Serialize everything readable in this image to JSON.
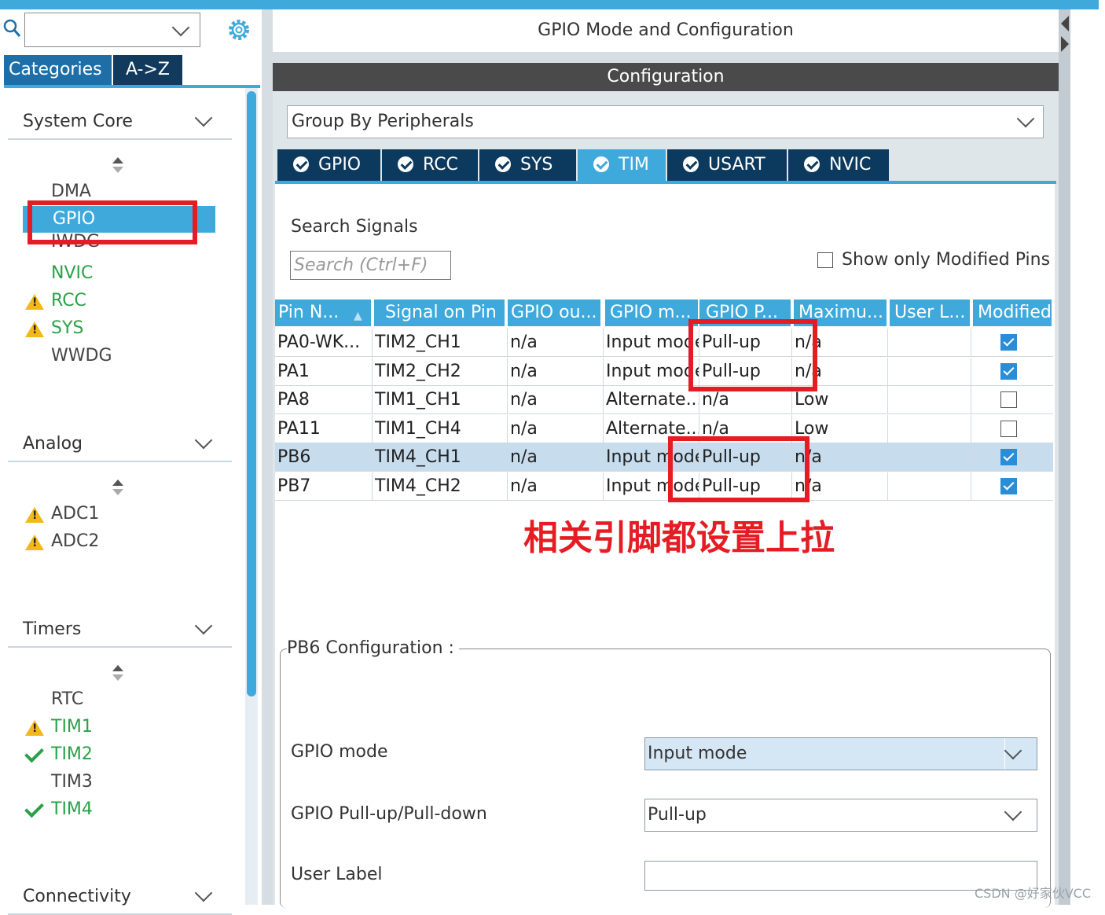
{
  "header": {
    "title": "GPIO Mode and Configuration",
    "config_bar": "Configuration"
  },
  "left": {
    "search_value": "",
    "tabs": [
      "Categories",
      "A->Z"
    ],
    "sections": [
      {
        "name": "System Core"
      },
      {
        "name": "Analog"
      },
      {
        "name": "Timers"
      },
      {
        "name": "Connectivity"
      }
    ],
    "system_core_items": [
      {
        "label": "DMA",
        "status": "none",
        "color": "gray"
      },
      {
        "label": "GPIO",
        "status": "selected",
        "color": "white"
      },
      {
        "label": "IWDG",
        "status": "none",
        "color": "gray"
      },
      {
        "label": "NVIC",
        "status": "none",
        "color": "green"
      },
      {
        "label": "RCC",
        "status": "warning",
        "color": "green"
      },
      {
        "label": "SYS",
        "status": "warning",
        "color": "green"
      },
      {
        "label": "WWDG",
        "status": "none",
        "color": "gray"
      }
    ],
    "analog_items": [
      {
        "label": "ADC1",
        "status": "warning",
        "color": "gray"
      },
      {
        "label": "ADC2",
        "status": "warning",
        "color": "gray"
      }
    ],
    "timer_items": [
      {
        "label": "RTC",
        "status": "none",
        "color": "gray"
      },
      {
        "label": "TIM1",
        "status": "warning",
        "color": "green"
      },
      {
        "label": "TIM2",
        "status": "ok",
        "color": "green"
      },
      {
        "label": "TIM3",
        "status": "none",
        "color": "gray"
      },
      {
        "label": "TIM4",
        "status": "ok",
        "color": "green"
      }
    ]
  },
  "config": {
    "group_by": "Group By Peripherals",
    "peripheral_tabs": [
      {
        "label": "GPIO",
        "active": false
      },
      {
        "label": "RCC",
        "active": false
      },
      {
        "label": "SYS",
        "active": false
      },
      {
        "label": "TIM",
        "active": true
      },
      {
        "label": "USART",
        "active": false
      },
      {
        "label": "NVIC",
        "active": false
      }
    ],
    "search_signals_label": "Search Signals",
    "search_placeholder": "Search (Ctrl+F)",
    "show_modified_label": "Show only Modified Pins",
    "show_modified_checked": false,
    "table": {
      "columns": [
        "Pin N...",
        "Signal on Pin",
        "GPIO ou...",
        "GPIO m...",
        "GPIO P...",
        "Maximu...",
        "User L...",
        "Modified"
      ],
      "rows": [
        {
          "pin": "PA0-WK...",
          "signal": "TIM2_CH1",
          "output": "n/a",
          "mode": "Input mode",
          "pull": "Pull-up",
          "max": "n/a",
          "label": "",
          "modified": true,
          "selected": false
        },
        {
          "pin": "PA1",
          "signal": "TIM2_CH2",
          "output": "n/a",
          "mode": "Input mode",
          "pull": "Pull-up",
          "max": "n/a",
          "label": "",
          "modified": true,
          "selected": false
        },
        {
          "pin": "PA8",
          "signal": "TIM1_CH1",
          "output": "n/a",
          "mode": "Alternate...",
          "pull": "n/a",
          "max": "Low",
          "label": "",
          "modified": false,
          "selected": false
        },
        {
          "pin": "PA11",
          "signal": "TIM1_CH4",
          "output": "n/a",
          "mode": "Alternate...",
          "pull": "n/a",
          "max": "Low",
          "label": "",
          "modified": false,
          "selected": false
        },
        {
          "pin": "PB6",
          "signal": "TIM4_CH1",
          "output": "n/a",
          "mode": "Input mode",
          "pull": "Pull-up",
          "max": "n/a",
          "label": "",
          "modified": true,
          "selected": true
        },
        {
          "pin": "PB7",
          "signal": "TIM4_CH2",
          "output": "n/a",
          "mode": "Input mode",
          "pull": "Pull-up",
          "max": "n/a",
          "label": "",
          "modified": true,
          "selected": false
        }
      ]
    },
    "annotation": "相关引脚都设置上拉",
    "pin_config": {
      "legend": "PB6 Configuration :",
      "gpio_mode_label": "GPIO mode",
      "gpio_mode_value": "Input mode",
      "pull_label": "GPIO Pull-up/Pull-down",
      "pull_value": "Pull-up",
      "user_label_label": "User Label",
      "user_label_value": ""
    }
  },
  "watermark": "CSDN @好家伙VCC",
  "colors": {
    "accent": "#3fa9dc",
    "dark_tab": "#0c3a5e",
    "highlight": "#e51c23",
    "ok_green": "#2aa148",
    "warning": "#f2b81b"
  }
}
